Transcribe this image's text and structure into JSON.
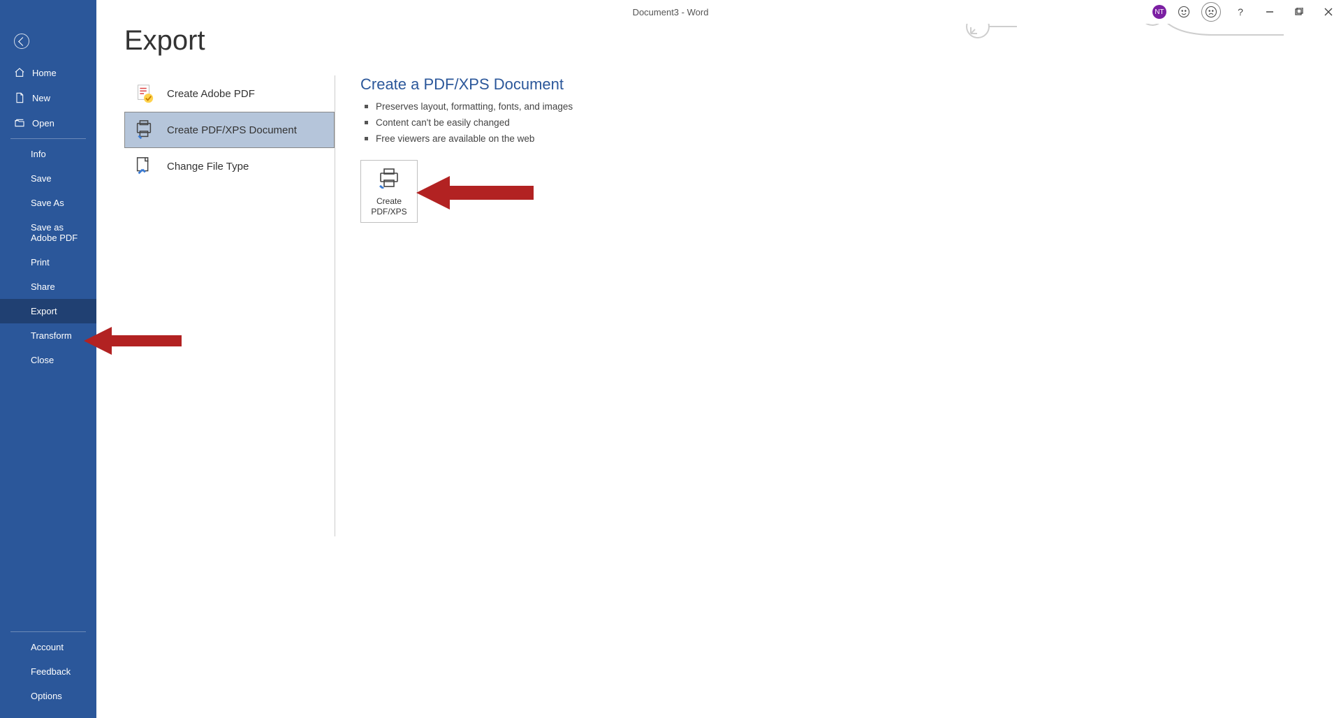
{
  "titlebar": {
    "document_title": "Document3  -  Word",
    "user_initials": "NT",
    "help_label": "?"
  },
  "sidebar": {
    "home": "Home",
    "new": "New",
    "open": "Open",
    "info": "Info",
    "save": "Save",
    "save_as": "Save As",
    "save_adobe": "Save as Adobe PDF",
    "print": "Print",
    "share": "Share",
    "export": "Export",
    "transform": "Transform",
    "close": "Close",
    "account": "Account",
    "feedback": "Feedback",
    "options": "Options"
  },
  "page_title": "Export",
  "export_options": {
    "create_adobe": "Create Adobe PDF",
    "create_pdfxps": "Create PDF/XPS Document",
    "change_type": "Change File Type"
  },
  "detail": {
    "heading": "Create a PDF/XPS Document",
    "bullet1": "Preserves layout, formatting, fonts, and images",
    "bullet2": "Content can't be easily changed",
    "bullet3": "Free viewers are available on the web",
    "button_line1": "Create",
    "button_line2": "PDF/XPS"
  }
}
